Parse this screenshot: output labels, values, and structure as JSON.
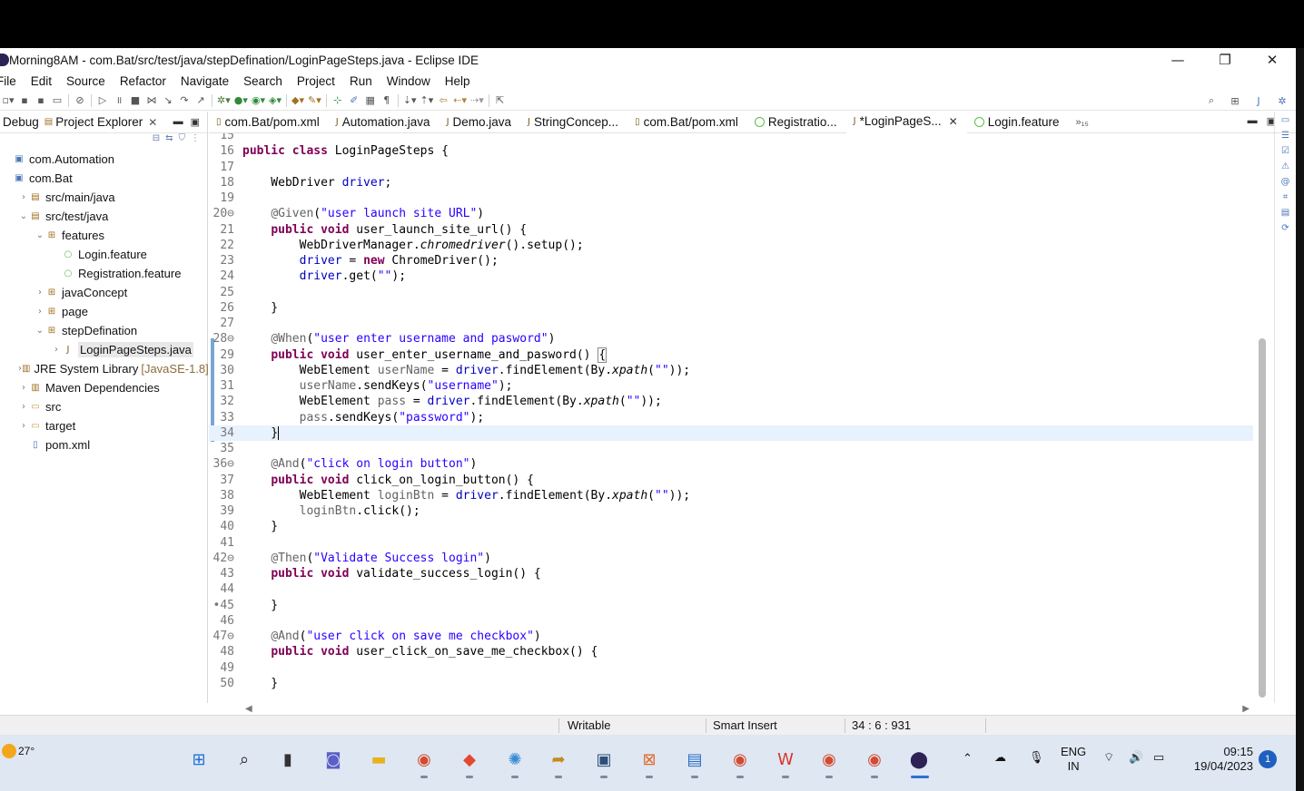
{
  "window": {
    "title": "Morning8AM - com.Bat/src/test/java/stepDefination/LoginPageSteps.java - Eclipse IDE",
    "minimize": "—",
    "restore": "❐",
    "close": "✕"
  },
  "menu": [
    "File",
    "Edit",
    "Source",
    "Refactor",
    "Navigate",
    "Search",
    "Project",
    "Run",
    "Window",
    "Help"
  ],
  "left_panel": {
    "tabs": [
      {
        "label": "Debug"
      },
      {
        "label": "Project Explorer",
        "close": "✕"
      }
    ],
    "tree": [
      {
        "indent": 0,
        "twist": "",
        "icon": "project-icon",
        "label": "com.Automation",
        "suffix": ""
      },
      {
        "indent": 0,
        "twist": "",
        "icon": "project-icon",
        "label": "com.Bat",
        "suffix": ""
      },
      {
        "indent": 1,
        "twist": "›",
        "icon": "source-folder-icon",
        "label": "src/main/java",
        "suffix": ""
      },
      {
        "indent": 1,
        "twist": "⌄",
        "icon": "source-folder-icon",
        "label": "src/test/java",
        "suffix": ""
      },
      {
        "indent": 2,
        "twist": "⌄",
        "icon": "package-icon",
        "label": "features",
        "suffix": ""
      },
      {
        "indent": 3,
        "twist": "",
        "icon": "feature-file-icon",
        "label": "Login.feature",
        "suffix": ""
      },
      {
        "indent": 3,
        "twist": "",
        "icon": "feature-file-icon",
        "label": "Registration.feature",
        "suffix": ""
      },
      {
        "indent": 2,
        "twist": "›",
        "icon": "package-icon",
        "label": "javaConcept",
        "suffix": ""
      },
      {
        "indent": 2,
        "twist": "›",
        "icon": "package-icon",
        "label": "page",
        "suffix": ""
      },
      {
        "indent": 2,
        "twist": "⌄",
        "icon": "package-icon",
        "label": "stepDefination",
        "suffix": ""
      },
      {
        "indent": 3,
        "twist": "›",
        "icon": "java-file-icon",
        "label": "LoginPageSteps.java",
        "suffix": "",
        "selected": true
      },
      {
        "indent": 1,
        "twist": "›",
        "icon": "library-icon",
        "label": "JRE System Library",
        "suffix": "[JavaSE-1.8]"
      },
      {
        "indent": 1,
        "twist": "›",
        "icon": "library-icon",
        "label": "Maven Dependencies",
        "suffix": ""
      },
      {
        "indent": 1,
        "twist": "›",
        "icon": "folder-icon",
        "label": "src",
        "suffix": ""
      },
      {
        "indent": 1,
        "twist": "›",
        "icon": "folder-icon",
        "label": "target",
        "suffix": ""
      },
      {
        "indent": 1,
        "twist": "",
        "icon": "xml-file-icon",
        "label": "pom.xml",
        "suffix": ""
      }
    ]
  },
  "editor_tabs": [
    {
      "label": "com.Bat/pom.xml",
      "icon": "xml-file-icon",
      "active": false
    },
    {
      "label": "Automation.java",
      "icon": "java-file-icon",
      "active": false
    },
    {
      "label": "Demo.java",
      "icon": "java-file-icon",
      "active": false
    },
    {
      "label": "StringConcep...",
      "icon": "java-file-icon",
      "active": false
    },
    {
      "label": "com.Bat/pom.xml",
      "icon": "xml-file-icon",
      "active": false
    },
    {
      "label": "Registratio...",
      "icon": "feature-file-icon",
      "active": false
    },
    {
      "label": "*LoginPageS...",
      "icon": "java-file-icon",
      "active": true,
      "close": "✕"
    },
    {
      "label": "Login.feature",
      "icon": "feature-file-icon",
      "active": false
    }
  ],
  "editor_overflow": "»₁₅",
  "code": [
    {
      "n": "15",
      "html": ""
    },
    {
      "n": "16",
      "html": "<span class=\"kw\">public class</span> LoginPageSteps {"
    },
    {
      "n": "17",
      "html": ""
    },
    {
      "n": "18",
      "html": "    WebDriver <span class=\"fld\">driver</span>;"
    },
    {
      "n": "19",
      "html": ""
    },
    {
      "n": "20⊖",
      "html": "    <span class=\"ann\">@Given</span>(<span class=\"str\">\"user launch site URL\"</span>)"
    },
    {
      "n": "21",
      "html": "    <span class=\"kw\">public void</span> user_launch_site_url() {"
    },
    {
      "n": "22",
      "html": "        WebDriverManager.<span class=\"itl\">chromedriver</span>().setup();"
    },
    {
      "n": "23",
      "html": "        <span class=\"fld\">driver</span> = <span class=\"kw\">new</span> ChromeDriver();"
    },
    {
      "n": "24",
      "html": "        <span class=\"fld\">driver</span>.get(<span class=\"str\">\"\"</span>);"
    },
    {
      "n": "25",
      "html": ""
    },
    {
      "n": "26",
      "html": "    }"
    },
    {
      "n": "27",
      "html": ""
    },
    {
      "n": "28⊖",
      "html": "    <span class=\"ann\">@When</span>(<span class=\"str\">\"user enter username and pasword\"</span>)"
    },
    {
      "n": "29",
      "html": "    <span class=\"kw\">public void</span> user_enter_username_and_pasword() <span class=\"bracket-box\">{</span>"
    },
    {
      "n": "30",
      "html": "        WebElement <span class=\"ann\">userName</span> = <span class=\"fld\">driver</span>.findElement(By.<span class=\"itl\">xpath</span>(<span class=\"str\">\"\"</span>));"
    },
    {
      "n": "31",
      "html": "        <span class=\"ann\">userName</span>.sendKeys(<span class=\"str\">\"username\"</span>);"
    },
    {
      "n": "32",
      "html": "        WebElement <span class=\"ann\">pass</span> = <span class=\"fld\">driver</span>.findElement(By.<span class=\"itl\">xpath</span>(<span class=\"str\">\"\"</span>));"
    },
    {
      "n": "33",
      "html": "        <span class=\"ann\">pass</span>.sendKeys(<span class=\"str\">\"password\"</span>);"
    },
    {
      "n": "34",
      "html": "    }<span class=\"caret\"></span>",
      "current": true
    },
    {
      "n": "35",
      "html": ""
    },
    {
      "n": "36⊖",
      "html": "    <span class=\"ann\">@And</span>(<span class=\"str\">\"click on login button\"</span>)"
    },
    {
      "n": "37",
      "html": "    <span class=\"kw\">public void</span> click_on_login_button() {"
    },
    {
      "n": "38",
      "html": "        WebElement <span class=\"ann\">loginBtn</span> = <span class=\"fld\">driver</span>.findElement(By.<span class=\"itl\">xpath</span>(<span class=\"str\">\"\"</span>));"
    },
    {
      "n": "39",
      "html": "        <span class=\"ann\">loginBtn</span>.click();"
    },
    {
      "n": "40",
      "html": "    }"
    },
    {
      "n": "41",
      "html": ""
    },
    {
      "n": "42⊖",
      "html": "    <span class=\"ann\">@Then</span>(<span class=\"str\">\"Validate Success login\"</span>)"
    },
    {
      "n": "43",
      "html": "    <span class=\"kw\">public void</span> validate_success_login() {"
    },
    {
      "n": "44",
      "html": ""
    },
    {
      "n": "•45",
      "html": "    }"
    },
    {
      "n": "46",
      "html": ""
    },
    {
      "n": "47⊖",
      "html": "    <span class=\"ann\">@And</span>(<span class=\"str\">\"user click on save me checkbox\"</span>)"
    },
    {
      "n": "48",
      "html": "    <span class=\"kw\">public void</span> user_click_on_save_me_checkbox() {"
    },
    {
      "n": "49",
      "html": ""
    },
    {
      "n": "50",
      "html": "    }"
    }
  ],
  "status": {
    "writable": "Writable",
    "insert_mode": "Smart Insert",
    "position": "34 : 6 : 931"
  },
  "taskbar": {
    "temperature": "27°",
    "lang_top": "ENG",
    "lang_bottom": "IN",
    "time": "09:15",
    "date": "19/04/2023",
    "notifications": "1"
  },
  "colors": {
    "keyword": "#7f0055",
    "string": "#2a00ff",
    "field": "#0000c0",
    "annotation": "#646464",
    "current_line": "#e8f2fe",
    "taskbar": "#dfe7f2"
  }
}
